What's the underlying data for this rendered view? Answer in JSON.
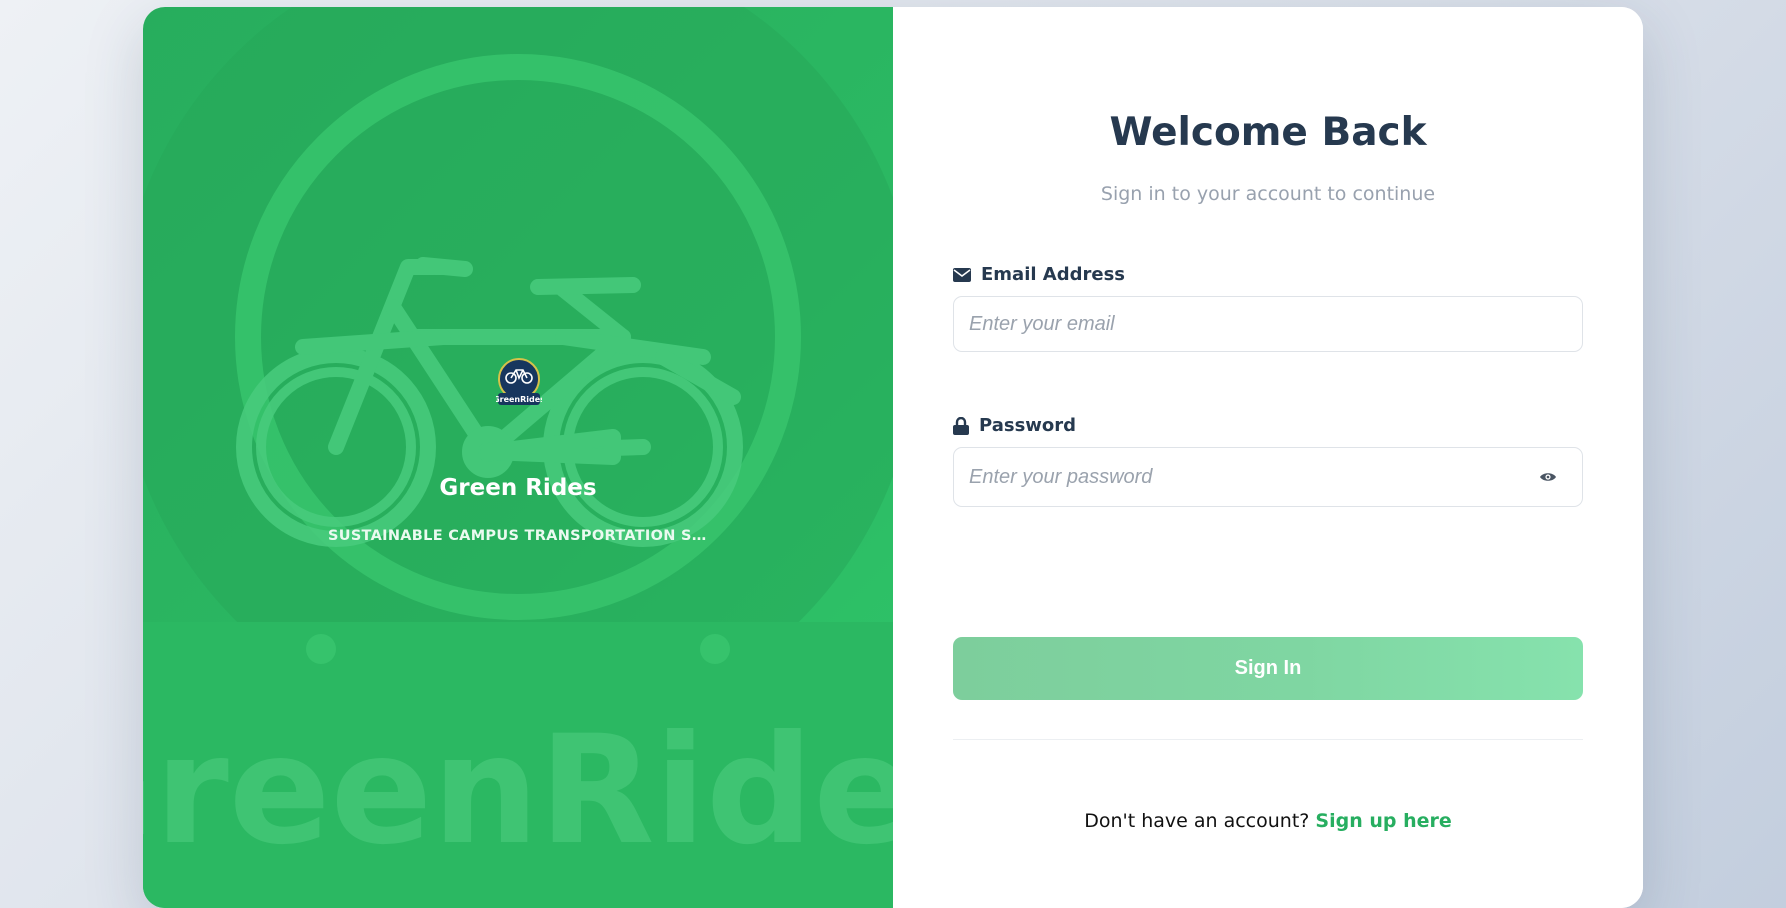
{
  "brand": {
    "name": "Green Rides",
    "tagline": "SUSTAINABLE CAMPUS TRANSPORTATION SOLUTIONS",
    "watermark_text": "GreenRides",
    "badge_text": "GreenRides"
  },
  "login": {
    "title": "Welcome Back",
    "subtitle": "Sign in to your account to continue",
    "email_label": "Email Address",
    "email_placeholder": "Enter your email",
    "email_value": "",
    "password_label": "Password",
    "password_placeholder": "Enter your password",
    "password_value": "",
    "submit_label": "Sign In",
    "signup_prompt": "Don't have an account?",
    "signup_link": "Sign up here"
  },
  "icons": {
    "email": "envelope-icon",
    "password": "lock-icon",
    "toggle": "eye-icon",
    "logo": "bicycle-logo"
  },
  "colors": {
    "brand_green": "#2bb862",
    "title_navy": "#26394f",
    "link_green": "#27ae60",
    "button_green": "#7fd6a2"
  }
}
